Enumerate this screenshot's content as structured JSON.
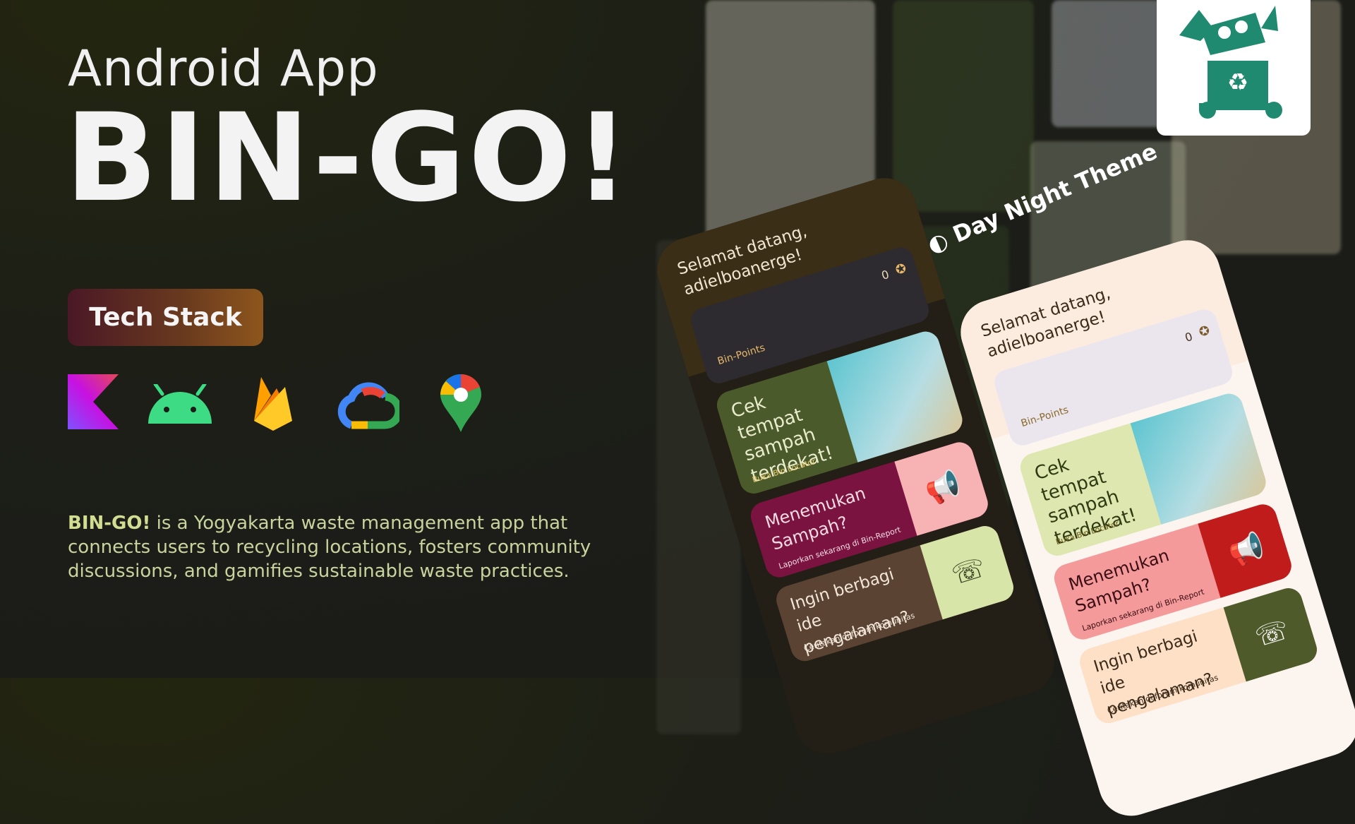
{
  "header": {
    "subtitle": "Android App",
    "title": "BIN-GO!"
  },
  "tech_stack": {
    "label": "Tech Stack",
    "icons": [
      "kotlin-icon",
      "android-icon",
      "firebase-icon",
      "google-cloud-icon",
      "google-maps-icon"
    ]
  },
  "description": {
    "brand": "BIN-GO!",
    "text": " is a Yogyakarta waste management app that connects users to recycling locations, fosters community discussions, and gamifies sustainable waste practices."
  },
  "theme_label": "Day Night Theme",
  "phones": {
    "dark": {
      "greeting": "Selamat datang, adielboanerge!",
      "points_value": "0",
      "points_label": "Bin-Points",
      "card1_title": "Cek tempat sampah terdekat!",
      "card1_sub": "Buka Bin Locator",
      "card2_title": "Menemukan Sampah?",
      "card2_sub": "Laporkan sekarang di Bin-Report",
      "card3_title": "Ingin berbagi ide pengalaman?",
      "card3_sub": "Ceritakan di forum komunitas"
    },
    "light": {
      "greeting": "Selamat datang, adielboanerge!",
      "points_value": "0",
      "points_label": "Bin-Points",
      "card1_title": "Cek tempat sampah terdekat!",
      "card1_sub": "Buka Bin Locator",
      "card2_title": "Menemukan Sampah?",
      "card2_sub": "Laporkan sekarang di Bin-Report",
      "card3_title": "Ingin berbagi ide pengalaman?",
      "card3_sub": "Ceritakan di forum komunitas"
    }
  },
  "colors": {
    "accent_green": "#1f8a70",
    "stack_gradient_start": "#4a1826",
    "stack_gradient_end": "#8d561d",
    "desc_text": "#c9d39d"
  }
}
